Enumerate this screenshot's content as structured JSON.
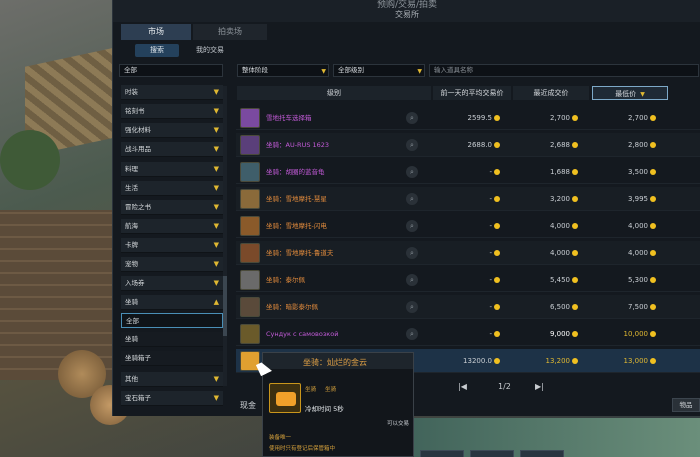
{
  "window": {
    "title": "预购/交易/拍卖",
    "subtitle": "交易所"
  },
  "tabs": [
    {
      "label": "市场"
    },
    {
      "label": "拍卖场"
    }
  ],
  "subtabs": [
    {
      "label": "搜索"
    },
    {
      "label": "我的交易"
    }
  ],
  "category_select": {
    "value": "全部"
  },
  "filters": {
    "tier": "整体阶段",
    "grade": "全部级别",
    "search_placeholder": "输入道具名称"
  },
  "categories": [
    {
      "label": "时装",
      "arrow": "▼"
    },
    {
      "label": "铭刻书",
      "arrow": "▼"
    },
    {
      "label": "强化材料",
      "arrow": "▼"
    },
    {
      "label": "战斗用品",
      "arrow": "▼"
    },
    {
      "label": "料理",
      "arrow": "▼"
    },
    {
      "label": "生活",
      "arrow": "▼"
    },
    {
      "label": "冒险之书",
      "arrow": "▼"
    },
    {
      "label": "航海",
      "arrow": "▼"
    },
    {
      "label": "卡牌",
      "arrow": "▼"
    },
    {
      "label": "宠物",
      "arrow": "▼"
    },
    {
      "label": "入场券",
      "arrow": "▼"
    },
    {
      "label": "坐骑",
      "arrow": "▲"
    },
    {
      "label": "全部"
    },
    {
      "label": "坐骑"
    },
    {
      "label": "坐骑箱子"
    },
    {
      "label": "其他",
      "arrow": "▼"
    },
    {
      "label": "宝石箱子",
      "arrow": "▼"
    }
  ],
  "columns": {
    "grade": "级别",
    "avg_price": "前一天的平均交易价",
    "recent_price": "最近成交价",
    "lowest_price": "最低价",
    "sort_icon": "▼"
  },
  "rows": [
    {
      "name": "雪地托车选择箱",
      "name_color": "#c35bd8",
      "icon_color": "#7a4aa0",
      "avg": "2599.5",
      "recent": "2,700",
      "lowest": "2,700"
    },
    {
      "name": "坐骑：AU-RUS 1623",
      "name_color": "#c35bd8",
      "icon_color": "#5a3f7a",
      "avg": "2688.0",
      "recent": "2,688",
      "lowest": "2,800"
    },
    {
      "name": "坐骑：胡圈的蓝音龟",
      "name_color": "#c35bd8",
      "icon_color": "#3f5e6a",
      "avg": "-",
      "recent": "1,688",
      "lowest": "3,500"
    },
    {
      "name": "坐骑：雪地摩托-慧星",
      "name_color": "#e08a3c",
      "icon_color": "#8a6a3a",
      "avg": "-",
      "recent": "3,200",
      "lowest": "3,995"
    },
    {
      "name": "坐骑：雪地摩托-闪电",
      "name_color": "#e08a3c",
      "icon_color": "#8a5a2a",
      "avg": "-",
      "recent": "4,000",
      "lowest": "4,000"
    },
    {
      "name": "坐骑：雪地摩托-鲁道夫",
      "name_color": "#e08a3c",
      "icon_color": "#7a4a2a",
      "avg": "-",
      "recent": "4,000",
      "lowest": "4,000"
    },
    {
      "name": "坐骑：泰尔佩",
      "name_color": "#e08a3c",
      "icon_color": "#6a6a6a",
      "avg": "-",
      "recent": "5,450",
      "lowest": "5,300"
    },
    {
      "name": "坐骑：暗影泰尔佩",
      "name_color": "#e08a3c",
      "icon_color": "#5a4a3a",
      "avg": "-",
      "recent": "6,500",
      "lowest": "7,500"
    },
    {
      "name": "Сундук с самовозкой",
      "name_color": "#c35bd8",
      "icon_color": "#6a5a2a",
      "avg": "-",
      "recent": "9,000",
      "lowest": "10,000",
      "recent_color": "#ffffff",
      "lowest_color": "#e0b832"
    },
    {
      "name": "坐骑：灿烂的金云",
      "name_color": "#e2a246",
      "icon_color": "#e0a030",
      "avg": "13200.0",
      "recent": "13,200",
      "lowest": "13,000",
      "recent_color": "#e0b832",
      "lowest_color": "#e0b832"
    }
  ],
  "pagination": {
    "prev": "|◀",
    "page": "1/2",
    "next": "▶|"
  },
  "tooltip": {
    "title": "坐骑：灿烂的金云",
    "type": "坐骑",
    "kind": "坐骑",
    "cooldown": "冷却时间 5秒",
    "tradable": "可以交易",
    "desc1": "装备唯一",
    "desc2": "使用时只有登记后保管箱中"
  },
  "footer": {
    "cash_label": "现金",
    "items_button": "物品"
  },
  "colors": {
    "accent": "#e0b832",
    "panel": "#14191f",
    "highlight": "#1d3247"
  }
}
